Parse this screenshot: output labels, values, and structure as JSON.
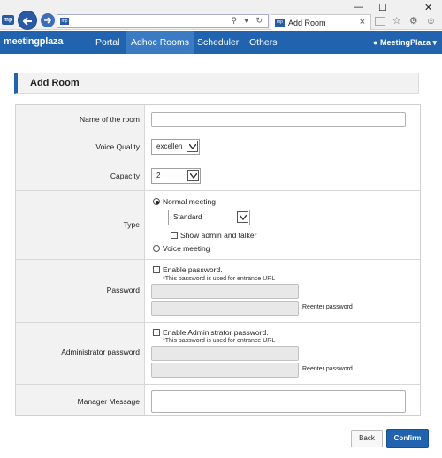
{
  "browser": {
    "tab_title": "Add Room",
    "address_icons": "⚲ ▾ ↻",
    "favicon_text": "mp",
    "window_controls": [
      "—",
      "☐",
      "✕"
    ],
    "toolbar_icons": "☆ ⚙ ☺"
  },
  "navbar": {
    "logo": "meetingplaza",
    "items": [
      "Portal",
      "Adhoc Rooms",
      "Scheduler",
      "Others"
    ],
    "active": "Adhoc Rooms",
    "user_menu": "MeetingPlaza ▾"
  },
  "page": {
    "title": "Add Room"
  },
  "form": {
    "name_label": "Name of the room",
    "name_value": "",
    "voice_quality_label": "Voice Quality",
    "voice_quality_value": "excellen",
    "capacity_label": "Capacity",
    "capacity_value": "2",
    "type_label": "Type",
    "type_normal": "Normal meeting",
    "type_normal_selected": true,
    "type_normal_mode": "Standard",
    "show_admin_talker": "Show admin and talker",
    "type_voice": "Voice meeting",
    "password_label": "Password",
    "enable_password": "Enable password.",
    "password_note": "*This password is used for entrance URL",
    "reenter_password": "Reenter password",
    "admin_password_label": "Administrator password",
    "enable_admin_password": "Enable Administrator password.",
    "admin_password_note": "*This password is used for entrance URL",
    "reenter_admin_password": "Reenter password",
    "manager_message_label": "Manager Message",
    "manager_message_value": ""
  },
  "actions": {
    "back": "Back",
    "confirm": "Confirm"
  },
  "colors": {
    "brand": "#2163af",
    "active_nav": "#3b7bc4"
  }
}
